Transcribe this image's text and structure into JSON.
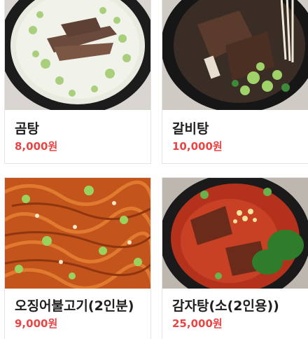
{
  "menu": {
    "items": [
      {
        "name": "곰탕",
        "price": "8,000원",
        "image_icon": "gomtang-photo"
      },
      {
        "name": "갈비탕",
        "price": "10,000원",
        "image_icon": "galbitang-photo"
      },
      {
        "name": "오징어불고기(2인분)",
        "price": "9,000원",
        "image_icon": "ojingeo-bulgogi-photo"
      },
      {
        "name": "감자탕(소(2인용))",
        "price": "25,000원",
        "image_icon": "gamjatang-photo"
      }
    ],
    "colors": {
      "price": "#e94545",
      "title": "#1f1f1f",
      "card_border": "#e4e4e4"
    }
  }
}
